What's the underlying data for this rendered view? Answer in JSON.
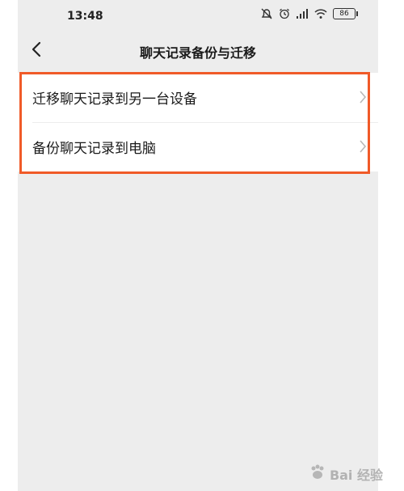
{
  "status_bar": {
    "time": "13:48",
    "battery": "86"
  },
  "nav": {
    "title": "聊天记录备份与迁移"
  },
  "menu": {
    "items": [
      {
        "label": "迁移聊天记录到另一台设备"
      },
      {
        "label": "备份聊天记录到电脑"
      }
    ]
  },
  "highlight_color": "#f05a28",
  "background_color": "#ededed",
  "watermark": {
    "text": "Bai 经验"
  }
}
